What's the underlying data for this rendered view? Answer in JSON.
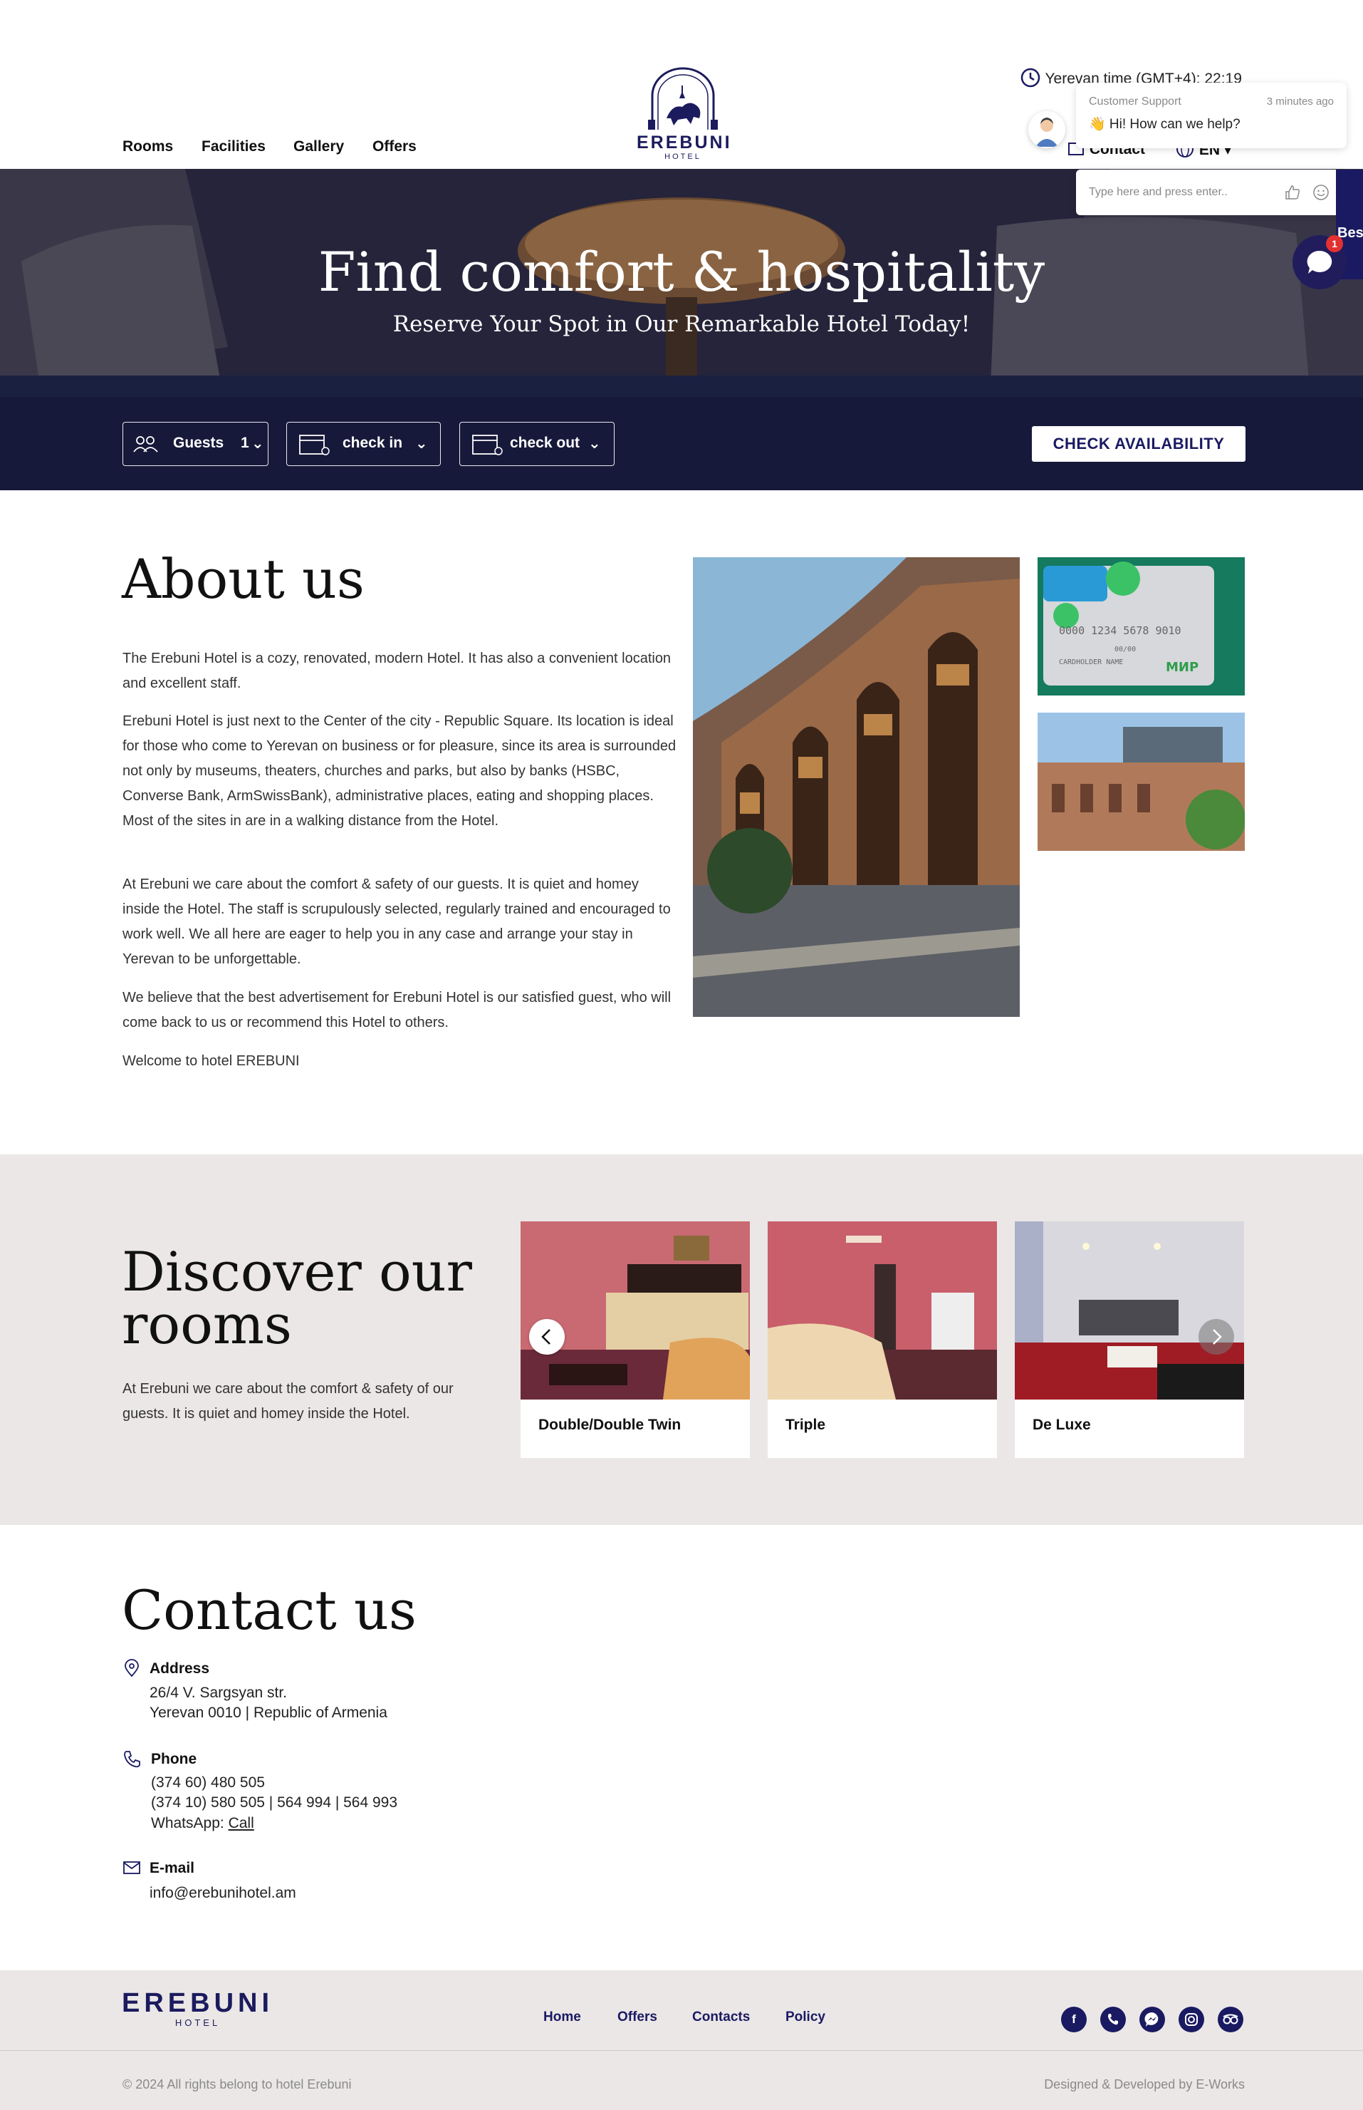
{
  "header": {
    "nav": [
      "Rooms",
      "Facilities",
      "Gallery",
      "Offers"
    ],
    "logo_word": "EREBUNI",
    "logo_sub": "HOTEL",
    "time": "Yerevan time (GMT+4): 22:19",
    "contact": "Contact",
    "language": "EN"
  },
  "chat": {
    "agent": "Customer Support",
    "ago": "3 minutes ago",
    "message": "👋 Hi! How can we help?",
    "placeholder": "Type here and press enter..",
    "badge": "1",
    "side_tab": "Best ...rs"
  },
  "hero": {
    "title": "Find comfort & hospitality",
    "subtitle": "Reserve Your Spot in Our Remarkable Hotel Today!",
    "guests_label": "Guests",
    "guests_value": "1",
    "check_in": "check in",
    "check_out": "check out",
    "check_button": "CHECK AVAILABILITY"
  },
  "about": {
    "title": "About us",
    "paragraphs": [
      "The Erebuni Hotel is a cozy, renovated, modern Hotel. It has also a convenient location and excellent staff.",
      "Erebuni Hotel is just next to the Center of the city - Republic Square. Its location is ideal for those who come to Yerevan on business or for pleasure, since its area is surrounded not only by museums, theaters, churches and parks, but also by banks (HSBC, Converse Bank, ArmSwissBank), administrative places, eating and shopping places. Most of the sites in are in a walking distance from the Hotel.",
      "At Erebuni we care about the comfort & safety of our guests. It is quiet and homey inside the Hotel. The staff is scrupulously selected, regularly trained and encouraged to work well. We all here are eager to help you in any case and arrange your stay in Yerevan to be unforgettable.",
      "We believe that the best advertisement for Erebuni Hotel is our satisfied guest, who will come back to us or recommend this Hotel to others.",
      "Welcome to hotel EREBUNI"
    ],
    "card_number": "0000 1234 5678 9010",
    "card_holder": "CARDHOLDER NAME",
    "card_date": "00/00",
    "card_brand": "МИР"
  },
  "rooms": {
    "title_line1": "Discover our",
    "title_line2": "rooms",
    "description": "At Erebuni we care about the comfort & safety of our guests. It is quiet and homey inside the Hotel.",
    "cards": [
      "Double/Double Twin",
      "Triple",
      "De Luxe"
    ]
  },
  "contact": {
    "title": "Contact us",
    "address_label": "Address",
    "address_line1": "26/4 V. Sargsyan str.",
    "address_line2": "Yerevan 0010 | Republic of Armenia",
    "phone_label": "Phone",
    "phone_line1": "(374 60) 480 505",
    "phone_line2": "(374 10) 580 505 | 564 994 | 564 993",
    "whatsapp_label": "WhatsApp:",
    "whatsapp_link": "Call",
    "email_label": "E-mail",
    "email": "info@erebunihotel.am"
  },
  "footer": {
    "logo_word": "EREBUNI",
    "logo_sub": "HOTEL",
    "links": [
      "Home",
      "Offers",
      "Contacts",
      "Policy"
    ],
    "social": [
      "facebook-icon",
      "viber-icon",
      "messenger-icon",
      "instagram-icon",
      "tripadvisor-icon"
    ],
    "copyright": "© 2024 All rights belong to hotel Erebuni",
    "designed": "Designed & Developed by E-Works"
  },
  "colors": {
    "brand_navy": "#1a1a62",
    "section_bg": "#ebe7e6",
    "chat_badge": "#e33030"
  }
}
